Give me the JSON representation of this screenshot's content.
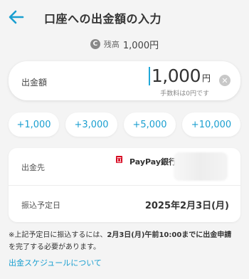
{
  "header": {
    "title": "口座への出金額の入力"
  },
  "balance": {
    "label": "残高",
    "value": "1,000円"
  },
  "amount": {
    "label": "出金額",
    "value": "1,000",
    "unit": "円",
    "fee_note": "手数料は0円です"
  },
  "quick_amounts": [
    "+1,000",
    "+3,000",
    "+5,000",
    "+10,000"
  ],
  "destination": {
    "label": "出金先",
    "bank_name": "PayPay銀行"
  },
  "transfer": {
    "label": "振込予定日",
    "date": "2025年2月3日(月)"
  },
  "note": {
    "prefix": "※上記予定日に振込するには、",
    "deadline": "2月3日(月)午前10:00",
    "middle": "までに出金申請",
    "suffix": "を完了する必要があります。"
  },
  "schedule_link": "出金スケジュールについて",
  "colors": {
    "accent": "#1a9fd0",
    "bank_red": "#d6001c"
  }
}
